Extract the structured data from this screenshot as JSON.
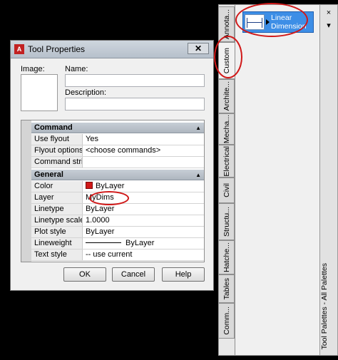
{
  "palette": {
    "title": "Tool Palettes - All Palettes",
    "tabs": [
      {
        "label": "Annota..."
      },
      {
        "label": "Custom",
        "active": true
      },
      {
        "label": "Archite..."
      },
      {
        "label": "Mecha..."
      },
      {
        "label": "Electrical"
      },
      {
        "label": "Civil"
      },
      {
        "label": "Structu..."
      },
      {
        "label": "Hatche..."
      },
      {
        "label": "Tables"
      },
      {
        "label": "Comm..."
      }
    ],
    "tool": {
      "label_line1": "Linear",
      "label_line2": "Dimension",
      "icon": "linear-dimension-icon"
    },
    "close_glyph": "×",
    "menu_glyph": "▾"
  },
  "dialog": {
    "title": "Tool Properties",
    "app_icon_letter": "A",
    "close_glyph": "✕",
    "image_label": "Image:",
    "name_label": "Name:",
    "name_value": "",
    "description_label": "Description:",
    "description_value": "",
    "sections": {
      "command": {
        "title": "Command",
        "rows": [
          {
            "name": "Use flyout",
            "value": "Yes"
          },
          {
            "name": "Flyout options",
            "value": "<choose commands>"
          },
          {
            "name": "Command stri...",
            "value": ""
          }
        ]
      },
      "general": {
        "title": "General",
        "rows": [
          {
            "name": "Color",
            "value": "ByLayer"
          },
          {
            "name": "Layer",
            "value": "MyDims"
          },
          {
            "name": "Linetype",
            "value": "ByLayer"
          },
          {
            "name": "Linetype scale",
            "value": "1.0000"
          },
          {
            "name": "Plot style",
            "value": "ByLayer"
          },
          {
            "name": "Lineweight",
            "value": "ByLayer"
          },
          {
            "name": "Text style",
            "value": "-- use current"
          }
        ]
      }
    },
    "buttons": {
      "ok": "OK",
      "cancel": "Cancel",
      "help": "Help"
    },
    "collapse_glyph": "▲"
  },
  "colors": {
    "annotation": "#d01818",
    "selection": "#3d8ee6",
    "swatch": "#d01818"
  }
}
